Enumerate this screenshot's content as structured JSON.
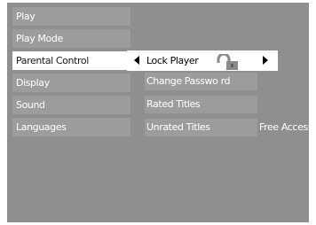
{
  "main_menu": {
    "items": [
      {
        "label": "Play"
      },
      {
        "label": "Play Mode"
      },
      {
        "label": "Parental Control",
        "selected": true
      },
      {
        "label": "Display"
      },
      {
        "label": "Sound"
      },
      {
        "label": "Languages"
      }
    ]
  },
  "submenu": {
    "lock_player": {
      "label": "Lock Player",
      "icon": "unlocked-padlock-icon"
    },
    "items": [
      {
        "label": "Change Passwo rd"
      },
      {
        "label": "Rated Titles"
      },
      {
        "label": "Unrated Titles",
        "value": "Free Access"
      }
    ]
  },
  "colors": {
    "screen_background": "#8f8f8f",
    "item_background": "#9c9c9c",
    "highlight": "#ffffff",
    "text": "#ffffff",
    "highlight_text": "#1a1a1a"
  }
}
